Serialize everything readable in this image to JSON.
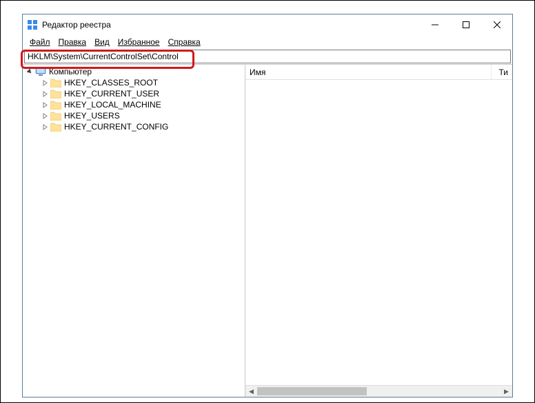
{
  "window": {
    "title": "Редактор реестра"
  },
  "menu": {
    "file": "Файл",
    "edit": "Правка",
    "view": "Вид",
    "favorites": "Избранное",
    "help": "Справка"
  },
  "addressbar": {
    "path": "HKLM\\System\\CurrentControlSet\\Control"
  },
  "tree": {
    "root": "Компьютер",
    "items": [
      "HKEY_CLASSES_ROOT",
      "HKEY_CURRENT_USER",
      "HKEY_LOCAL_MACHINE",
      "HKEY_USERS",
      "HKEY_CURRENT_CONFIG"
    ]
  },
  "list": {
    "col_name": "Имя",
    "col_type": "Ти"
  }
}
